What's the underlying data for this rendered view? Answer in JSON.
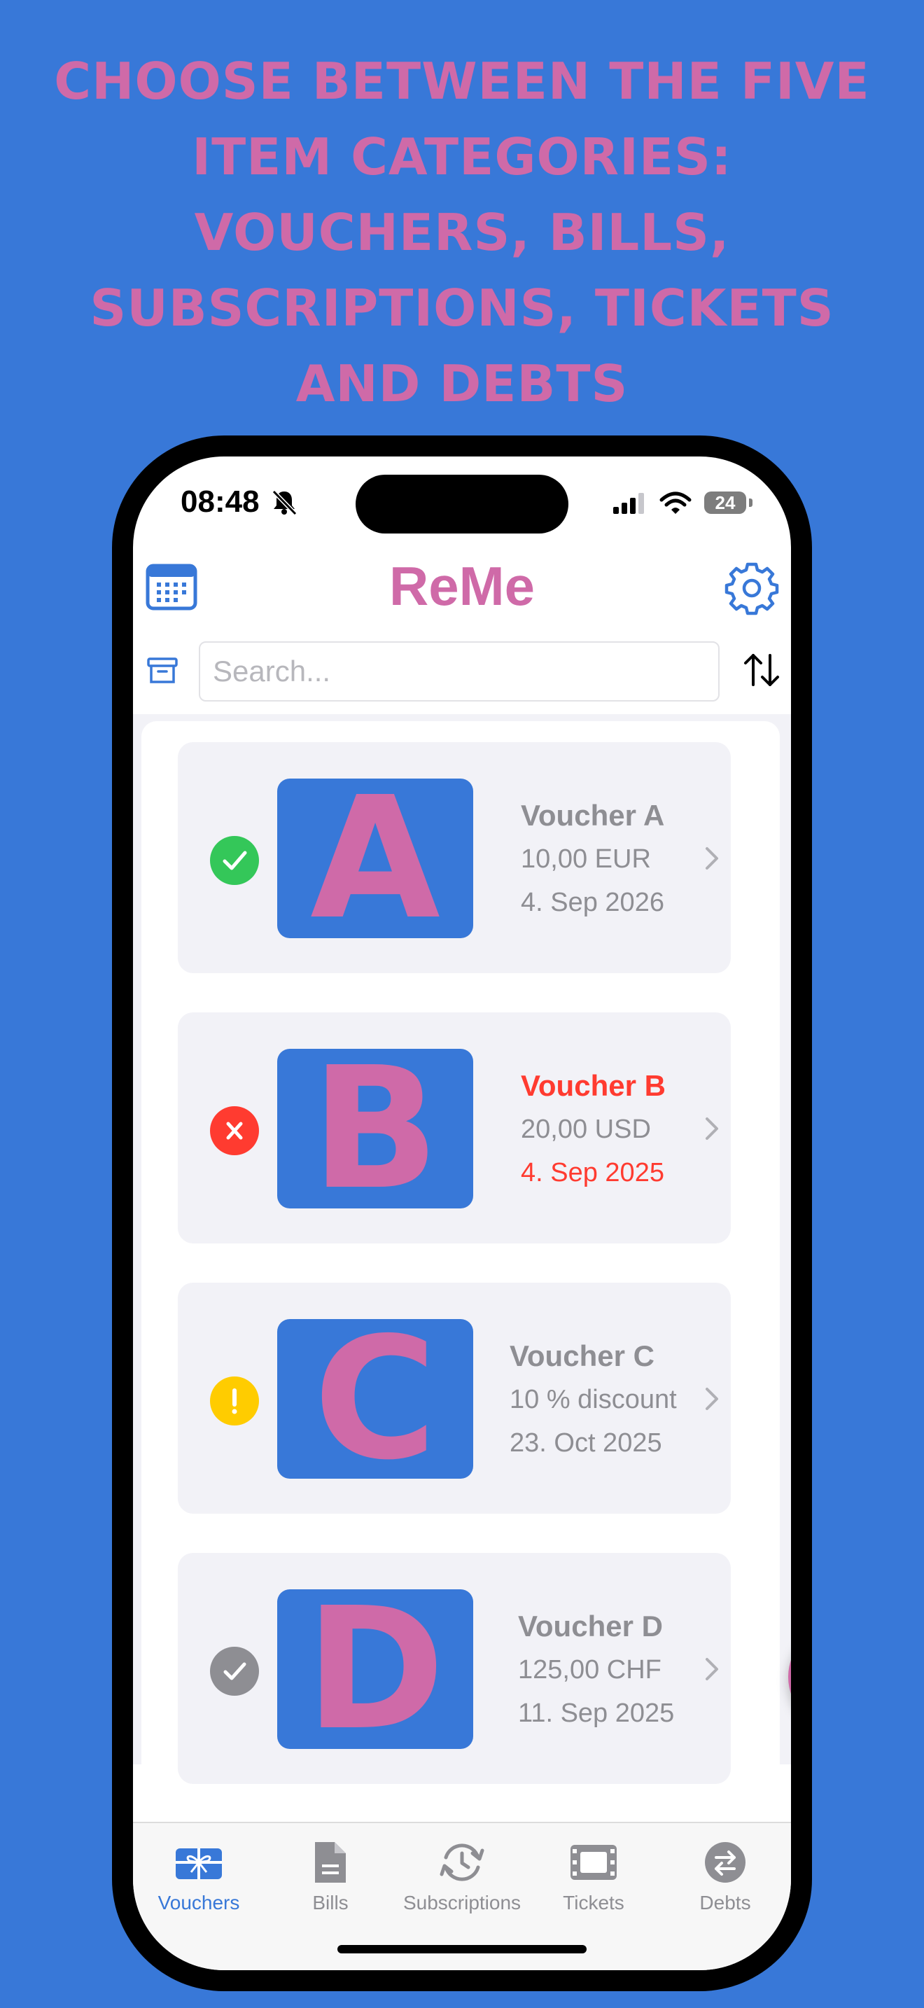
{
  "headline": [
    "CHOOSE BETWEEN THE FIVE",
    "ITEM CATEGORIES:",
    "VOUCHERS, BILLS,",
    "SUBSCRIPTIONS, TICKETS",
    "AND DEBTS"
  ],
  "status_bar": {
    "time": "08:48",
    "battery": "24"
  },
  "app": {
    "title": "ReMe",
    "brand_color": "#cf6aa8",
    "accent_color": "#3878d8",
    "search_placeholder": "Search..."
  },
  "vouchers": [
    {
      "letter": "A",
      "name": "Voucher A",
      "value": "10,00 EUR",
      "date": "4. Sep 2026",
      "status": "valid",
      "status_color": "#34c759",
      "status_icon": "checkmark-icon"
    },
    {
      "letter": "B",
      "name": "Voucher B",
      "value": "20,00 USD",
      "date": "4. Sep 2025",
      "status": "expired",
      "status_color": "#ff3b30",
      "status_icon": "x-icon"
    },
    {
      "letter": "C",
      "name": "Voucher C",
      "value": "10 % discount",
      "date": "23. Oct 2025",
      "status": "expiring-soon",
      "status_color": "#ffcc00",
      "status_icon": "exclamation-icon"
    },
    {
      "letter": "D",
      "name": "Voucher D",
      "value": "125,00 CHF",
      "date": "11. Sep 2025",
      "status": "redeemed",
      "status_color": "#8e8e93",
      "status_icon": "checkmark-icon"
    }
  ],
  "tabs": [
    {
      "label": "Vouchers",
      "icon": "gift-icon",
      "active": true
    },
    {
      "label": "Bills",
      "icon": "document-icon",
      "active": false
    },
    {
      "label": "Subscriptions",
      "icon": "clock-arrows-icon",
      "active": false
    },
    {
      "label": "Tickets",
      "icon": "ticket-icon",
      "active": false
    },
    {
      "label": "Debts",
      "icon": "arrows-exchange-icon",
      "active": false
    }
  ]
}
